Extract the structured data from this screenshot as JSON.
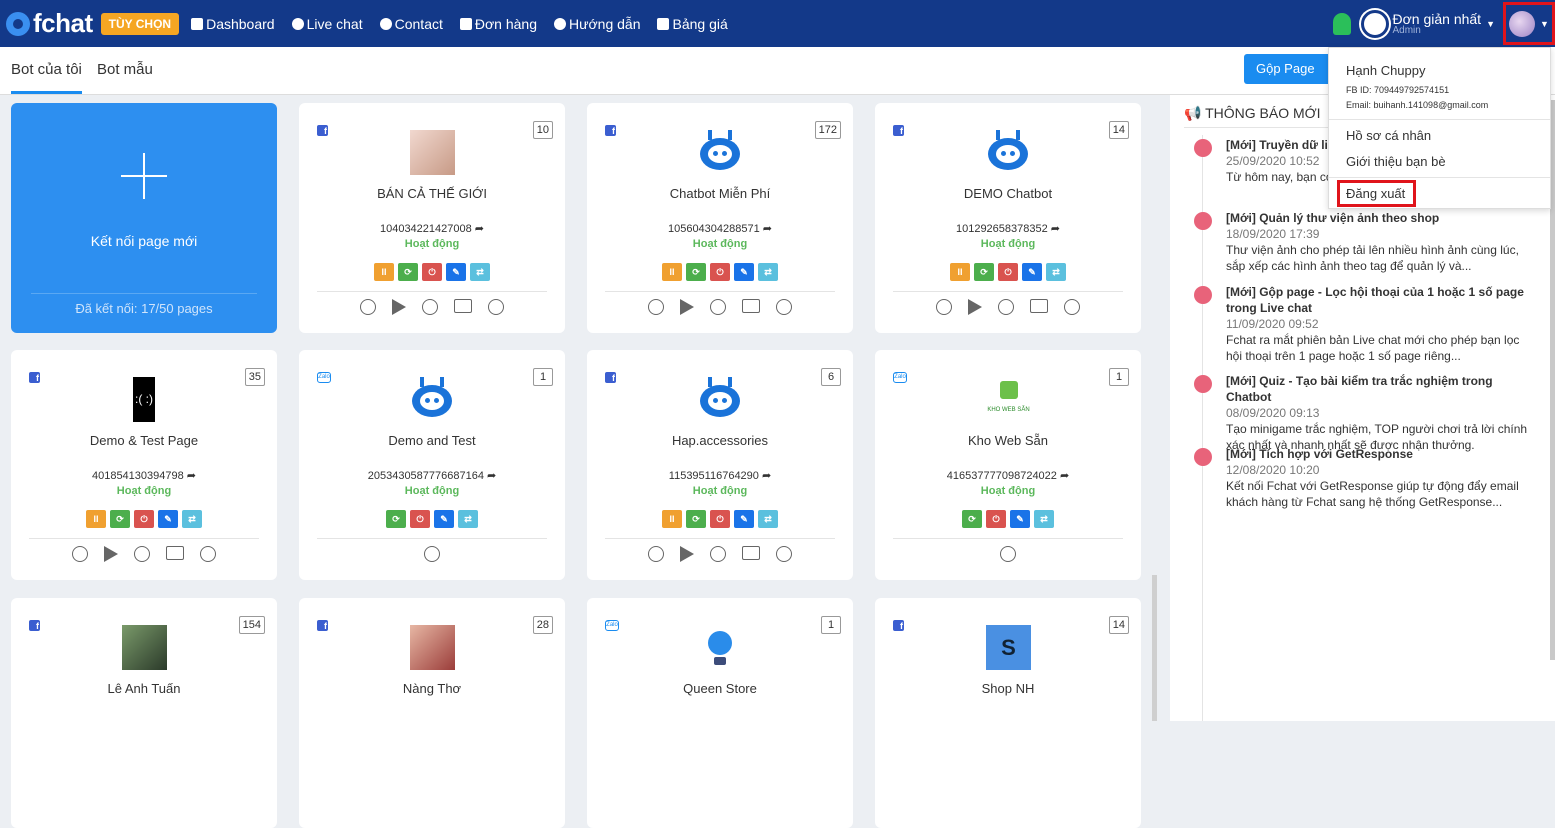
{
  "header": {
    "logo_text": "fchat",
    "option_badge": "TÙY CHỌN",
    "nav": [
      {
        "label": "Dashboard",
        "icon": "dashboard-icon"
      },
      {
        "label": "Live chat",
        "icon": "chat-icon"
      },
      {
        "label": "Contact",
        "icon": "contact-icon"
      },
      {
        "label": "Đơn hàng",
        "icon": "cart-icon"
      },
      {
        "label": "Hướng dẫn",
        "icon": "play-icon"
      },
      {
        "label": "Bảng giá",
        "icon": "price-icon"
      }
    ],
    "brand_name": "Đơn giản nhất",
    "brand_role": "Admin"
  },
  "subnav": {
    "tabs": [
      "Bot của tôi",
      "Bot mẫu"
    ],
    "merge_button": "Gộp Page"
  },
  "new_page_card": {
    "label": "Kết nối page mới",
    "count": "Đã kết nối: 17/50 pages"
  },
  "pages": [
    {
      "name": "BÁN CẢ THẾ GIỚI",
      "id": "104034221427008",
      "count": "10",
      "status": "Hoạt động",
      "platform": "facebook"
    },
    {
      "name": "Chatbot Miễn Phí",
      "id": "105604304288571",
      "count": "172",
      "status": "Hoạt động",
      "platform": "facebook"
    },
    {
      "name": "DEMO Chatbot",
      "id": "101292658378352",
      "count": "14",
      "status": "Hoạt động",
      "platform": "facebook"
    },
    {
      "name": "Demo & Test Page",
      "id": "401854130394798",
      "count": "35",
      "status": "Hoạt động",
      "platform": "facebook"
    },
    {
      "name": "Demo and Test",
      "id": "2053430587776687164",
      "count": "1",
      "status": "Hoạt động",
      "platform": "zalo"
    },
    {
      "name": "Hap.accessories",
      "id": "115395116764290",
      "count": "6",
      "status": "Hoạt động",
      "platform": "facebook"
    },
    {
      "name": "Kho Web Sẵn",
      "id": "4165377770987240​22",
      "count": "1",
      "status": "Hoạt động",
      "platform": "zalo"
    },
    {
      "name": "Lê Anh Tuấn",
      "count": "154",
      "platform": "facebook"
    },
    {
      "name": "Nàng Thơ",
      "count": "28",
      "platform": "facebook"
    },
    {
      "name": "Queen Store",
      "count": "1",
      "platform": "zalo"
    },
    {
      "name": "Shop NH",
      "count": "14",
      "platform": "facebook"
    }
  ],
  "thumb_texts": {
    "demo_test": ":(    :)",
    "kho": "KHO WEB SẴN",
    "shop": "S"
  },
  "notifications": {
    "title": "THÔNG BÁO MỚI",
    "items": [
      {
        "title": "[Mới] Truyền dữ liệ",
        "date": "25/09/2020 10:52",
        "text": "Từ hôm nay, bạn có ... Fchat và đẩy các thô"
      },
      {
        "title": "[Mới] Quản lý thư viện ảnh theo shop",
        "date": "18/09/2020 17:39",
        "text": "Thư viện ảnh cho phép tải lên nhiều hình ảnh cùng lúc, sắp xếp các hình ảnh theo tag để quản lý và..."
      },
      {
        "title": "[Mới] Gộp page - Lọc hội thoại của 1 hoặc 1 số page trong Live chat",
        "date": "11/09/2020 09:52",
        "text": "Fchat ra mắt phiên bản Live chat mới cho phép bạn lọc hội thoại trên 1 page hoặc 1 số page riêng..."
      },
      {
        "title": "[Mới] Quiz - Tạo bài kiểm tra trắc nghiệm trong Chatbot",
        "date": "08/09/2020 09:13",
        "text": "Tạo minigame trắc nghiệm, TOP người chơi trả lời chính xác nhất và nhanh nhất sẽ được nhận thưởng."
      },
      {
        "title": "[Mới] Tích hợp với GetResponse",
        "date": "12/08/2020 10:20",
        "text": "Kết nối Fchat với GetResponse giúp tự động đẩy email khách hàng từ Fchat sang hệ thống GetResponse..."
      }
    ]
  },
  "user_menu": {
    "name": "Hạnh Chuppy",
    "fb_id": "FB ID: 709449792574151",
    "email": "Email: buihanh.141098@gmail.com",
    "profile": "Hồ sơ cá nhân",
    "invite": "Giới thiệu bạn bè",
    "logout": "Đăng xuất"
  }
}
